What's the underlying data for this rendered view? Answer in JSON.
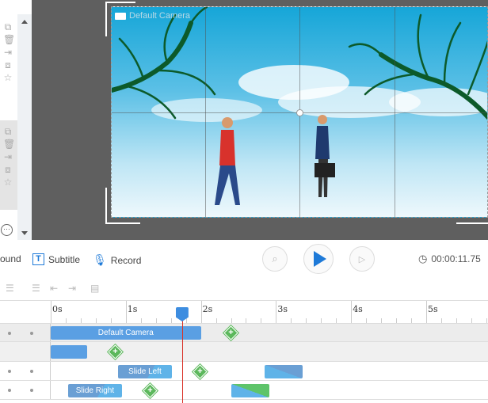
{
  "canvas": {
    "camera_label": "Default Camera"
  },
  "toolbar": {
    "background_label": "round",
    "subtitle_label": "Subtitle",
    "record_label": "Record",
    "time": "00:00:11.75"
  },
  "timeline": {
    "ticks": [
      "0s",
      "1s",
      "2s",
      "3s",
      "4s",
      "5s"
    ],
    "playhead_seconds": 1.75,
    "rows": [
      {
        "bar_label": "Default Camera"
      },
      {
        "bar_label": ""
      },
      {
        "bar_label": "Slide Left"
      },
      {
        "bar_label": "Slide Right"
      }
    ]
  },
  "colors": {
    "accent": "#1e7ad8",
    "bar": "#5a9fe3",
    "keyframe": "#5cb85c",
    "playhead": "#d93025"
  }
}
